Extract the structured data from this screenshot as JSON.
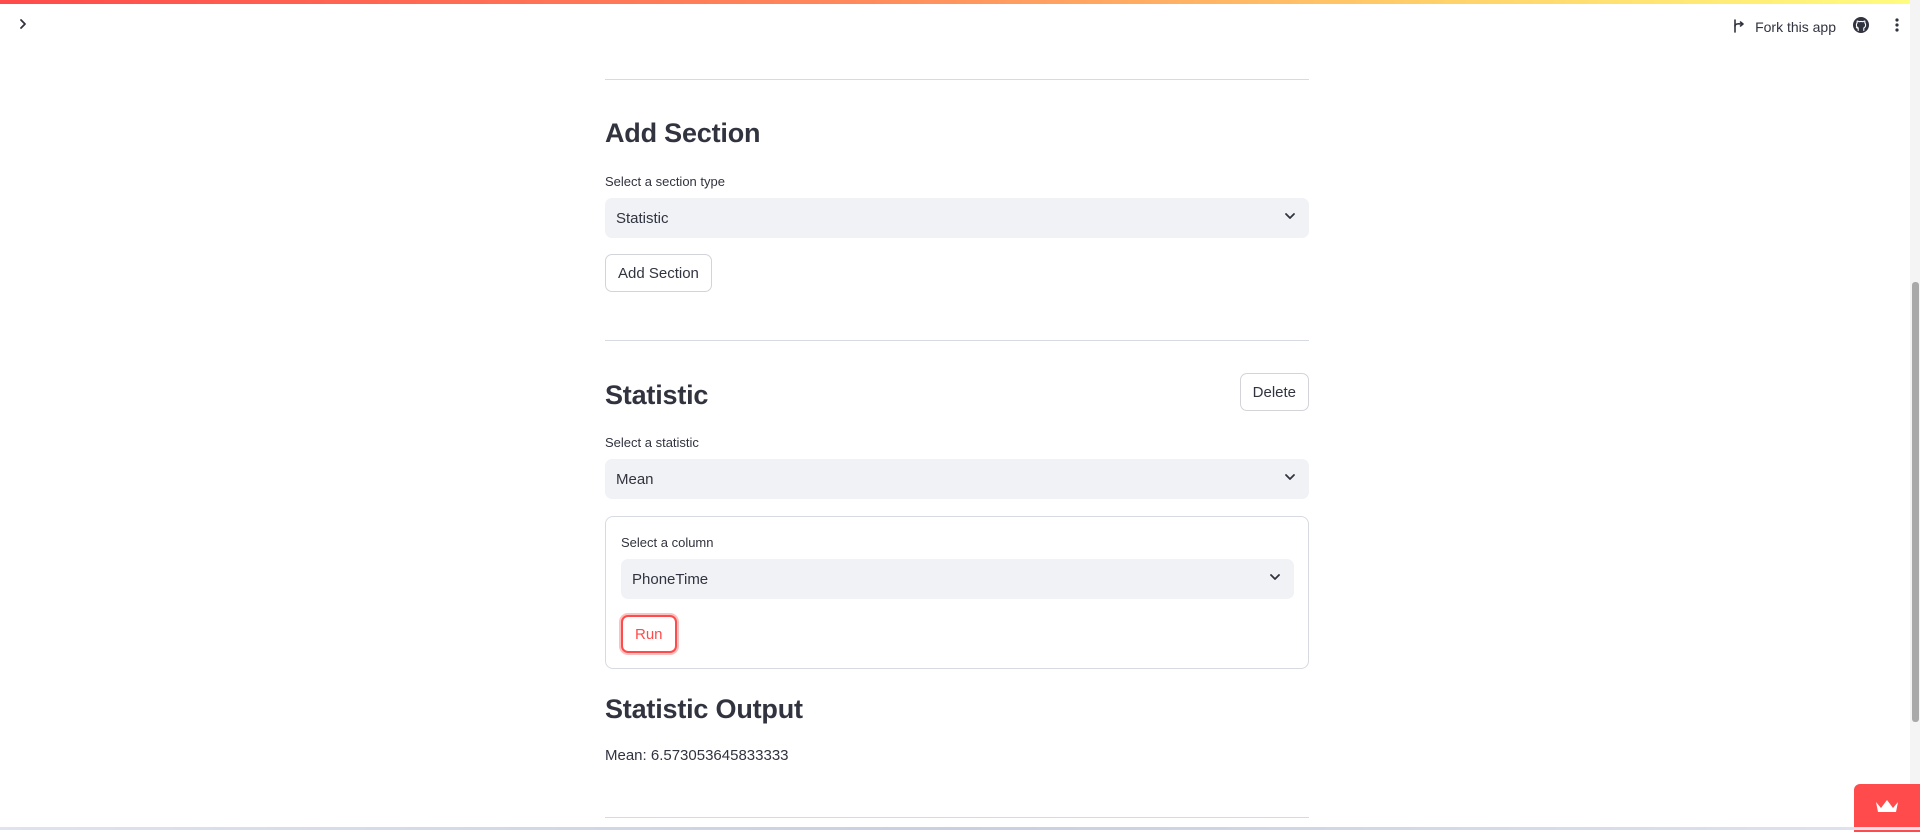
{
  "toolbar": {
    "fork_label": "Fork this app"
  },
  "add_section": {
    "heading": "Add Section",
    "select_label": "Select a section type",
    "select_value": "Statistic",
    "button_label": "Add Section"
  },
  "statistic": {
    "heading": "Statistic",
    "delete_label": "Delete",
    "stat_label": "Select a statistic",
    "stat_value": "Mean",
    "column_label": "Select a column",
    "column_value": "PhoneTime",
    "run_label": "Run"
  },
  "output": {
    "heading": "Statistic Output",
    "result_text": "Mean: 6.573053645833333"
  },
  "icons": {
    "expand": "chevron-right-icon",
    "fork": "fork-icon",
    "github": "github-icon",
    "menu": "more-vertical-icon",
    "dropdown": "chevron-down-icon",
    "badge": "crown-icon"
  },
  "colors": {
    "accent": "#ff4b4b",
    "select_bg": "#f0f2f6",
    "text": "#31333f"
  }
}
